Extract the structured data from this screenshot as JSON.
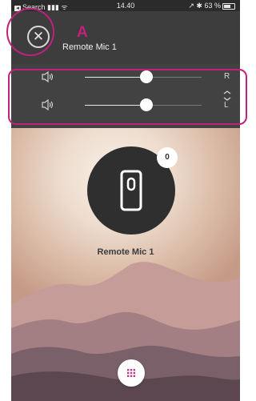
{
  "status_bar": {
    "carrier": "Search",
    "time": "14.40",
    "battery": "63 %"
  },
  "header": {
    "title": "Remote Mic 1"
  },
  "volume": {
    "right": {
      "label": "R",
      "level": 0.53
    },
    "left": {
      "label": "L",
      "level": 0.53
    }
  },
  "mic": {
    "name": "Remote Mic 1",
    "badge_count": "0"
  },
  "annotation": {
    "marker": "A"
  },
  "colors": {
    "annotation": "#c2207a",
    "accent": "#c03a8a",
    "header_bg": "#3d3d3d"
  },
  "icons": [
    "close-icon",
    "speaker-icon",
    "link-chevron-icon",
    "mic-device-icon",
    "grid-menu-icon"
  ]
}
